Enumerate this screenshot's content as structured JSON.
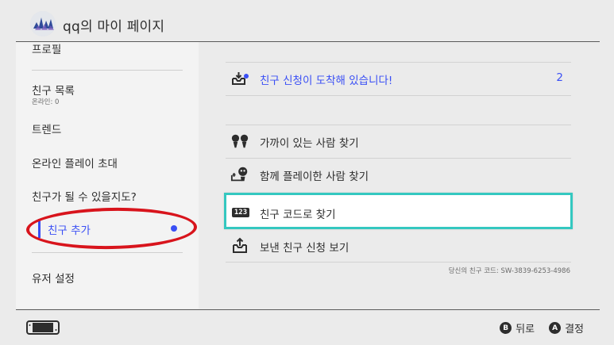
{
  "header": {
    "title": "qq의 마이 페이지"
  },
  "sidebar": {
    "items": [
      {
        "label": "프로필"
      },
      {
        "label": "친구 목록",
        "sub": "온라인: 0"
      },
      {
        "label": "트렌드"
      },
      {
        "label": "온라인 플레이 초대"
      },
      {
        "label": "친구가 될 수 있을지도?"
      },
      {
        "label": "친구 추가"
      },
      {
        "label": "유저 설정"
      }
    ]
  },
  "main": {
    "rows": [
      {
        "label": "친구 신청이 도착해 있습니다!",
        "count": "2",
        "icon": "friend-request-inbox-icon"
      },
      {
        "label": "가까이 있는 사람 찾기",
        "icon": "nearby-users-icon"
      },
      {
        "label": "함께 플레이한 사람 찾기",
        "icon": "played-with-icon"
      },
      {
        "label": "친구 코드로 찾기",
        "icon": "friend-code-icon",
        "icon_text": "123"
      },
      {
        "label": "보낸 친구 신청 보기",
        "icon": "sent-requests-icon"
      }
    ],
    "friend_code": "당신의 친구 코드: SW-3839-6253-4986"
  },
  "footer": {
    "back_key": "B",
    "back_label": "뒤로",
    "ok_key": "A",
    "ok_label": "결정"
  },
  "colors": {
    "accent": "#3a4ff5",
    "selection": "#34c8c0",
    "annotation": "#d8141c",
    "background": "#ebebeb"
  }
}
